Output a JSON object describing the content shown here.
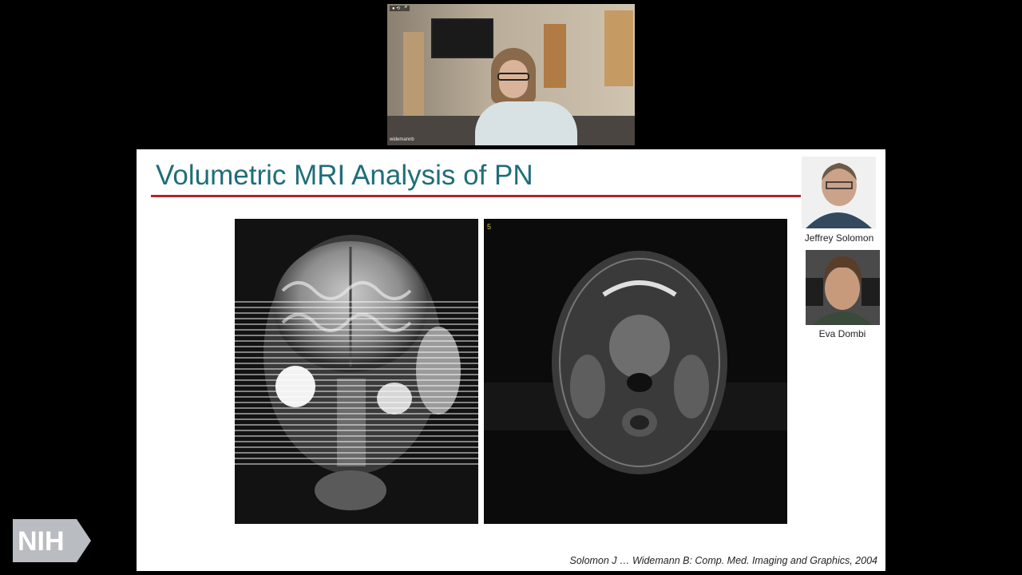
{
  "video": {
    "participant_name": "widemannb",
    "camera_indicator": "● ⟲ 🎤"
  },
  "slide": {
    "title": "Volumetric MRI Analysis of PN",
    "accent_color": "#1f6e79",
    "rule_color": "#b0262f",
    "mri_axial_slice_number": "5",
    "speakers": [
      {
        "name": "Jeffrey Solomon"
      },
      {
        "name": "Eva Dombi"
      }
    ],
    "citation": "Solomon J … Widemann B: Comp. Med. Imaging and Graphics, 2004"
  },
  "logo": {
    "text": "NIH",
    "color": "#b9bcc0"
  }
}
